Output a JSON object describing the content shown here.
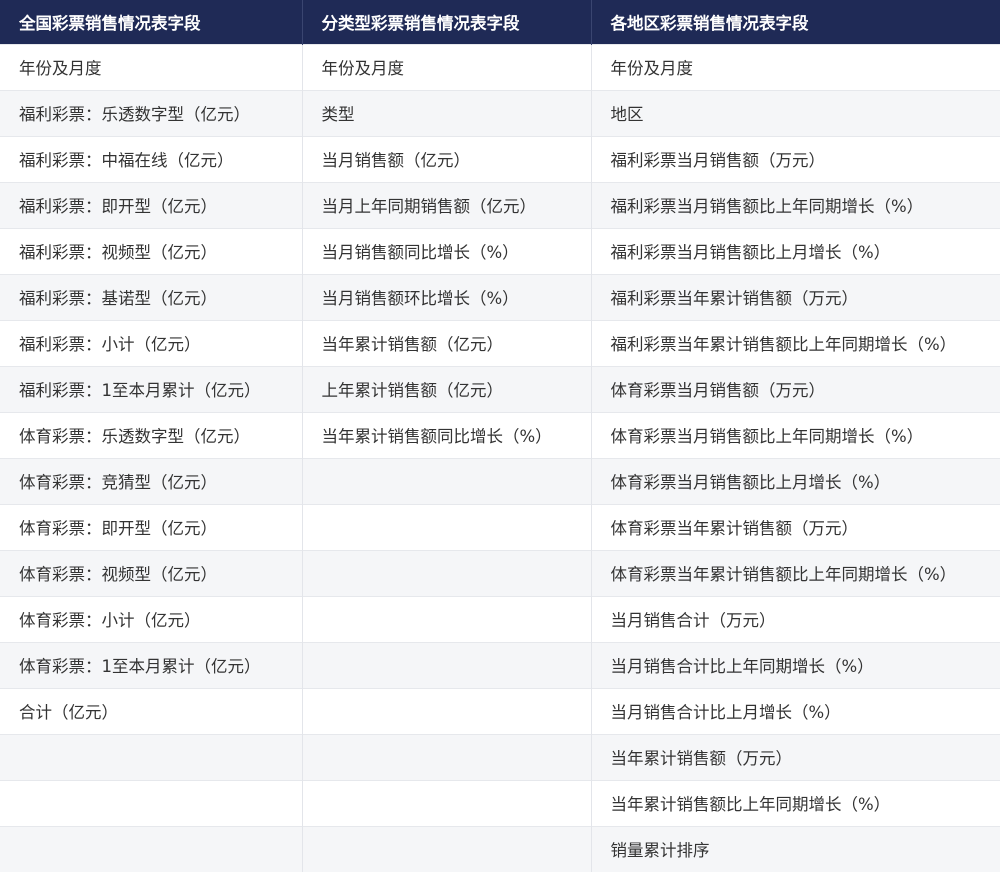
{
  "table": {
    "headers": [
      "全国彩票销售情况表字段",
      "分类型彩票销售情况表字段",
      "各地区彩票销售情况表字段"
    ],
    "rows": [
      [
        "年份及月度",
        "年份及月度",
        "年份及月度"
      ],
      [
        "福利彩票：乐透数字型（亿元）",
        "类型",
        "地区"
      ],
      [
        "福利彩票：中福在线（亿元）",
        "当月销售额（亿元）",
        "福利彩票当月销售额（万元）"
      ],
      [
        "福利彩票：即开型（亿元）",
        "当月上年同期销售额（亿元）",
        "福利彩票当月销售额比上年同期增长（%）"
      ],
      [
        "福利彩票：视频型（亿元）",
        "当月销售额同比增长（%）",
        "福利彩票当月销售额比上月增长（%）"
      ],
      [
        "福利彩票：基诺型（亿元）",
        "当月销售额环比增长（%）",
        "福利彩票当年累计销售额（万元）"
      ],
      [
        "福利彩票：小计（亿元）",
        "当年累计销售额（亿元）",
        "福利彩票当年累计销售额比上年同期增长（%）"
      ],
      [
        "福利彩票：1至本月累计（亿元）",
        "上年累计销售额（亿元）",
        "体育彩票当月销售额（万元）"
      ],
      [
        "体育彩票：乐透数字型（亿元）",
        "当年累计销售额同比增长（%）",
        "体育彩票当月销售额比上年同期增长（%）"
      ],
      [
        "体育彩票：竞猜型（亿元）",
        "",
        "体育彩票当月销售额比上月增长（%）"
      ],
      [
        "体育彩票：即开型（亿元）",
        "",
        "体育彩票当年累计销售额（万元）"
      ],
      [
        "体育彩票：视频型（亿元）",
        "",
        "体育彩票当年累计销售额比上年同期增长（%）"
      ],
      [
        "体育彩票：小计（亿元）",
        "",
        "当月销售合计（万元）"
      ],
      [
        "体育彩票：1至本月累计（亿元）",
        "",
        "当月销售合计比上年同期增长（%）"
      ],
      [
        "合计（亿元）",
        "",
        "当月销售合计比上月增长（%）"
      ],
      [
        "",
        "",
        "当年累计销售额（万元）"
      ],
      [
        "",
        "",
        "当年累计销售额比上年同期增长（%）"
      ],
      [
        "",
        "",
        "销量累计排序"
      ]
    ]
  }
}
